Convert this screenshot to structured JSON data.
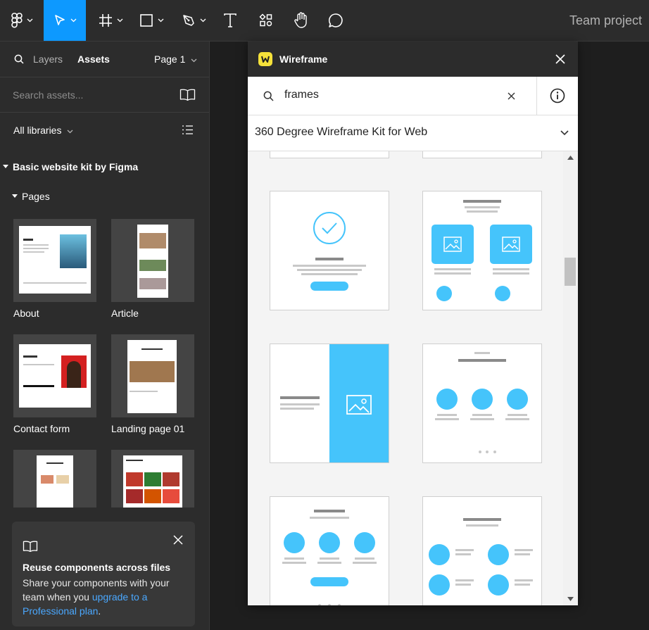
{
  "toolbar": {
    "project_name": "Team project",
    "tools": [
      "figma-menu-icon",
      "move-tool-icon",
      "frame-tool-icon",
      "shape-tool-icon",
      "pen-tool-icon",
      "text-tool-icon",
      "resources-icon",
      "hand-tool-icon",
      "comment-icon"
    ],
    "accent": "#0d99ff"
  },
  "left_panel": {
    "tabs": {
      "layers": "Layers",
      "assets": "Assets"
    },
    "page_selector": "Page 1",
    "search_placeholder": "Search assets...",
    "libraries_label": "All libraries",
    "library_name": "Basic website kit by Figma",
    "section_name": "Pages",
    "pages": [
      {
        "label": "About"
      },
      {
        "label": "Article"
      },
      {
        "label": "Contact form"
      },
      {
        "label": "Landing page 01"
      },
      {
        "label": ""
      },
      {
        "label": ""
      }
    ],
    "callout": {
      "title": "Reuse components across files",
      "body_before": "Share your components with your team when you ",
      "link": "upgrade to a Professional plan",
      "body_after": "."
    }
  },
  "plugin": {
    "title": "Wireframe",
    "search_value": "frames",
    "kit_selected": "360 Degree Wireframe Kit for Web",
    "accent": "#45c4fb"
  }
}
